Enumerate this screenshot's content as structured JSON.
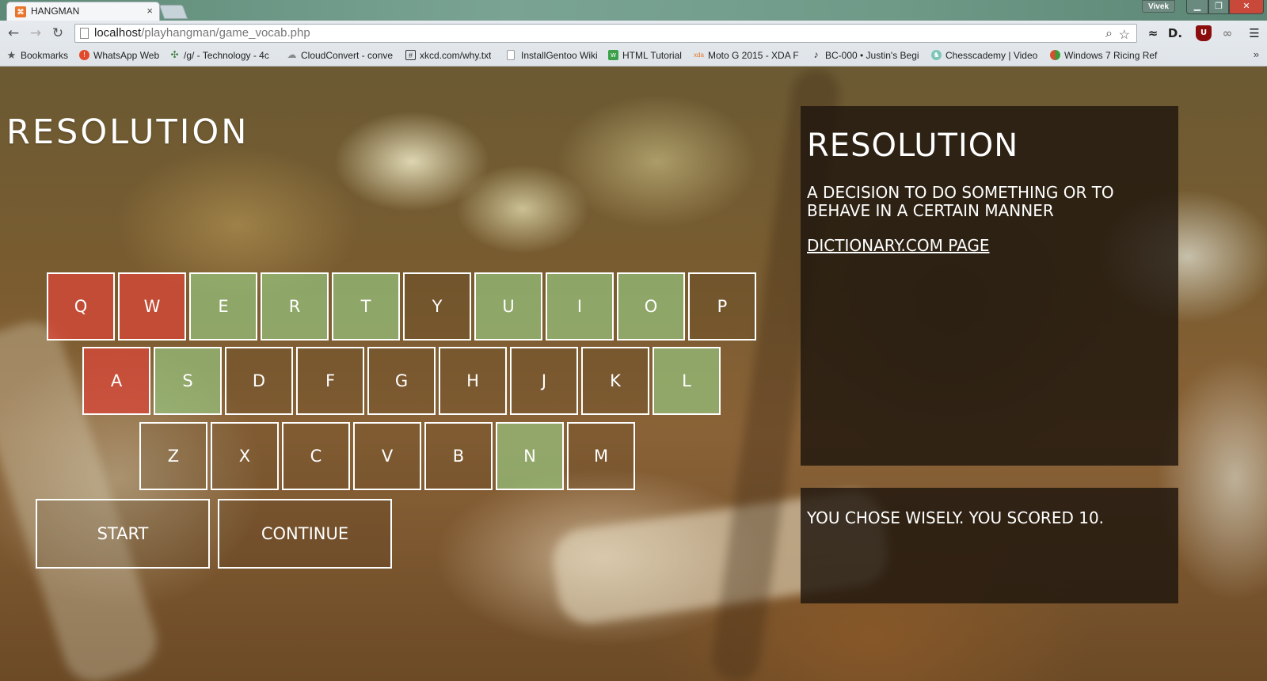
{
  "browser": {
    "tab_title": "HANGMAN",
    "tab_close": "×",
    "user_name": "Vivek",
    "url_host": "localhost",
    "url_path": "/playhangman/game_vocab.php",
    "bookmarks": [
      {
        "label": "Bookmarks",
        "icon": "star-icon",
        "color": "#555555"
      },
      {
        "label": "WhatsApp Web",
        "icon": "whatsapp-icon",
        "color": "#e24a2e"
      },
      {
        "label": "/g/ - Technology - 4c",
        "icon": "clover-icon",
        "color": "#3a7a3a"
      },
      {
        "label": "CloudConvert - conve",
        "icon": "cloud-icon",
        "color": "#888888"
      },
      {
        "label": "xkcd.com/why.txt",
        "icon": "xkcd-icon",
        "color": "#333333"
      },
      {
        "label": "InstallGentoo Wiki",
        "icon": "page-icon",
        "color": "#999999"
      },
      {
        "label": "HTML Tutorial",
        "icon": "w3-icon",
        "color": "#3da14a"
      },
      {
        "label": "Moto G 2015 - XDA F",
        "icon": "xda-icon",
        "color": "#e8762b"
      },
      {
        "label": "BC-000 • Justin's Begi",
        "icon": "guitar-icon",
        "color": "#222222"
      },
      {
        "label": "Chesscademy | Video",
        "icon": "chess-icon",
        "color": "#7fc6b8"
      },
      {
        "label": "Windows 7 Ricing Ref",
        "icon": "windows-icon",
        "color": "#d44f2f"
      }
    ]
  },
  "game": {
    "word": "RESOLUTION",
    "keyboard": {
      "row1": [
        {
          "letter": "Q",
          "state": "wrong"
        },
        {
          "letter": "W",
          "state": "wrong"
        },
        {
          "letter": "E",
          "state": "right"
        },
        {
          "letter": "R",
          "state": "right"
        },
        {
          "letter": "T",
          "state": "right"
        },
        {
          "letter": "Y",
          "state": "unused"
        },
        {
          "letter": "U",
          "state": "right"
        },
        {
          "letter": "I",
          "state": "right"
        },
        {
          "letter": "O",
          "state": "right"
        },
        {
          "letter": "P",
          "state": "unused"
        }
      ],
      "row2": [
        {
          "letter": "A",
          "state": "wrong"
        },
        {
          "letter": "S",
          "state": "right"
        },
        {
          "letter": "D",
          "state": "unused"
        },
        {
          "letter": "F",
          "state": "unused"
        },
        {
          "letter": "G",
          "state": "unused"
        },
        {
          "letter": "H",
          "state": "unused"
        },
        {
          "letter": "J",
          "state": "unused"
        },
        {
          "letter": "K",
          "state": "unused"
        },
        {
          "letter": "L",
          "state": "right"
        }
      ],
      "row3": [
        {
          "letter": "Z",
          "state": "unused"
        },
        {
          "letter": "X",
          "state": "unused"
        },
        {
          "letter": "C",
          "state": "unused"
        },
        {
          "letter": "V",
          "state": "unused"
        },
        {
          "letter": "B",
          "state": "unused"
        },
        {
          "letter": "N",
          "state": "right"
        },
        {
          "letter": "M",
          "state": "unused"
        }
      ]
    },
    "start_label": "START",
    "continue_label": "CONTINUE"
  },
  "definition": {
    "word": "RESOLUTION",
    "text": "A decision to do something or to behave in a certain manner",
    "link_label": "Dictionary.com page"
  },
  "result": {
    "message": "You chose wisely. You scored 10."
  },
  "colors": {
    "wrong_key": "#d64838",
    "right_key": "#96c882",
    "panel_bg": "#1e160e"
  }
}
